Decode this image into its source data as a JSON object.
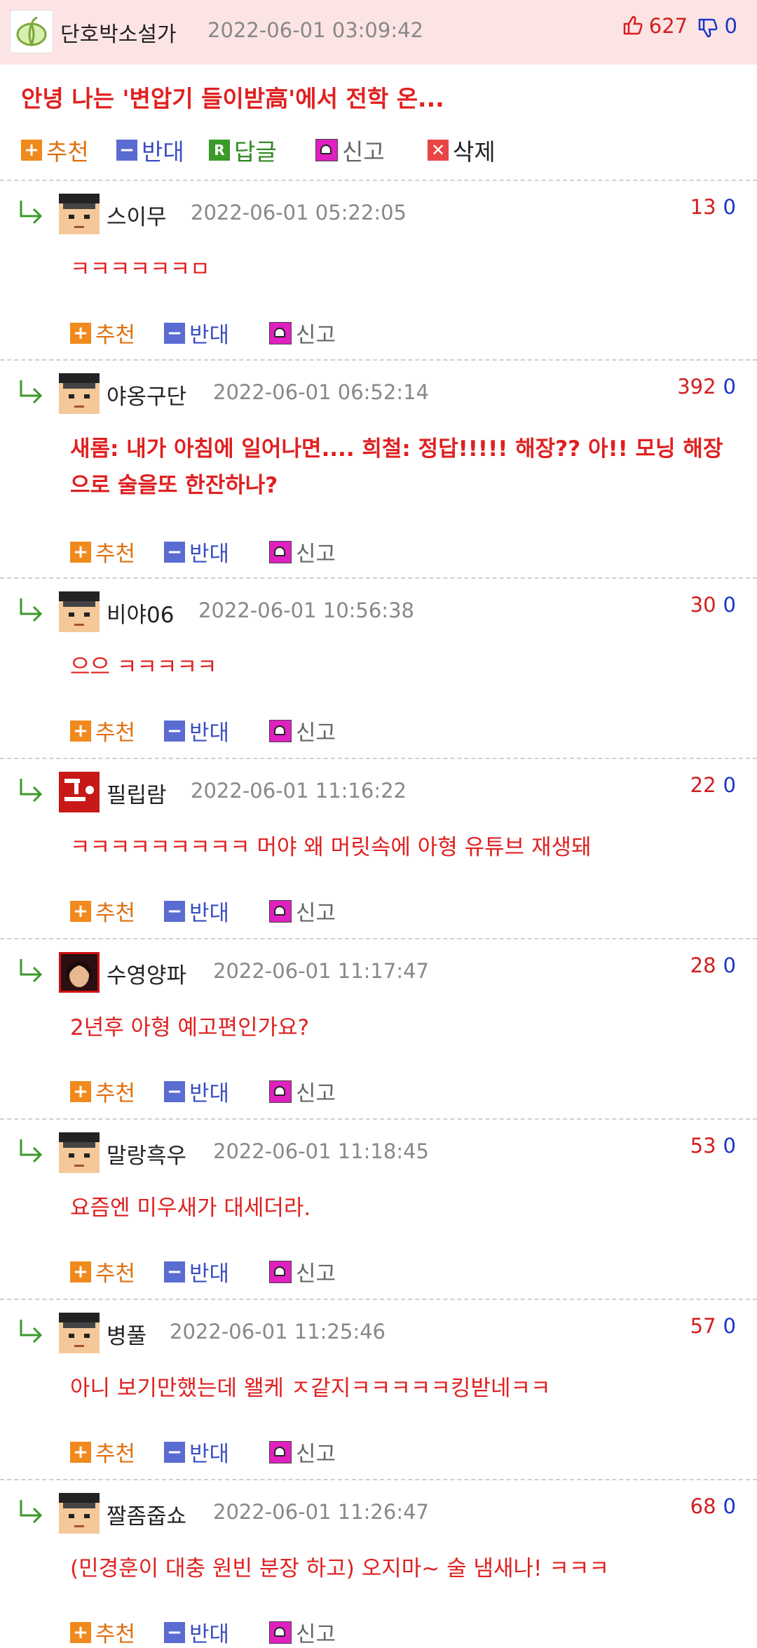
{
  "post": {
    "author": "단호박소설가",
    "date": "2022-06-01 03:09:42",
    "up": "627",
    "down": "0",
    "title": "안녕 나는 '변압기 들이받高'에서 전학 온...",
    "actions": {
      "recommend": "추천",
      "oppose": "반대",
      "reply": "답글",
      "report": "신고",
      "delete": "삭제"
    }
  },
  "comment_actions": {
    "recommend": "추천",
    "oppose": "반대",
    "report": "신고"
  },
  "comments": [
    {
      "name": "스이무",
      "date": "2022-06-01 05:22:05",
      "up": "13",
      "down": "0",
      "text": "ㅋㅋㅋㅋㅋㅋㅁ",
      "avatar": "graduate"
    },
    {
      "name": "야옹구단",
      "date": "2022-06-01 06:52:14",
      "up": "392",
      "down": "0",
      "text": "새롬: 내가 아침에 일어나면.... 희철: 정답!!!!! 해장?? 아!! 모닝 해장으로 술을또 한잔하나?",
      "avatar": "graduate"
    },
    {
      "name": "비야06",
      "date": "2022-06-01 10:56:38",
      "up": "30",
      "down": "0",
      "text": "으으 ㅋㅋㅋㅋㅋ",
      "avatar": "graduate"
    },
    {
      "name": "필립람",
      "date": "2022-06-01 11:16:22",
      "up": "22",
      "down": "0",
      "text": "ㅋㅋㅋㅋㅋㅋㅋㅋㅋ 머야 왜 머릿속에 아형 유튜브 재생돼",
      "avatar": "red-logo"
    },
    {
      "name": "수영양파",
      "date": "2022-06-01 11:17:47",
      "up": "28",
      "down": "0",
      "text": "2년후 아형 예고편인가요?",
      "avatar": "photo"
    },
    {
      "name": "말랑흑우",
      "date": "2022-06-01 11:18:45",
      "up": "53",
      "down": "0",
      "text": "요즘엔 미우새가 대세더라.",
      "avatar": "graduate"
    },
    {
      "name": "병풀",
      "date": "2022-06-01 11:25:46",
      "up": "57",
      "down": "0",
      "text": "아니 보기만했는데 왤케 ㅈ같지ㅋㅋㅋㅋㅋ킹받네ㅋㅋ",
      "avatar": "graduate"
    },
    {
      "name": "짤좀줍쇼",
      "date": "2022-06-01 11:26:47",
      "up": "68",
      "down": "0",
      "text": "(민경훈이 대충 원빈 분장 하고) 오지마~ 술 냄새나! ㅋㅋㅋ",
      "avatar": "graduate"
    }
  ]
}
